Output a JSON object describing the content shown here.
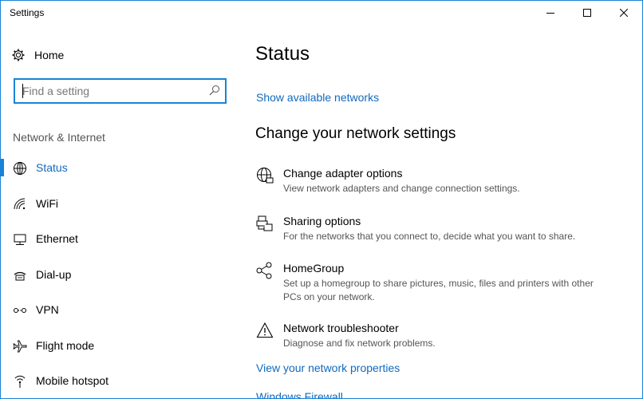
{
  "window": {
    "title": "Settings"
  },
  "sidebar": {
    "home_label": "Home",
    "search_placeholder": "Find a setting",
    "section_label": "Network & Internet",
    "items": [
      {
        "label": "Status",
        "icon": "globe-icon"
      },
      {
        "label": "WiFi",
        "icon": "wifi-icon"
      },
      {
        "label": "Ethernet",
        "icon": "ethernet-icon"
      },
      {
        "label": "Dial-up",
        "icon": "dialup-icon"
      },
      {
        "label": "VPN",
        "icon": "vpn-icon"
      },
      {
        "label": "Flight mode",
        "icon": "airplane-icon"
      },
      {
        "label": "Mobile hotspot",
        "icon": "hotspot-icon"
      }
    ]
  },
  "main": {
    "title": "Status",
    "show_networks_link": "Show available networks",
    "section_heading": "Change your network settings",
    "options": [
      {
        "title": "Change adapter options",
        "description": "View network adapters and change connection settings.",
        "icon": "adapter-icon"
      },
      {
        "title": "Sharing options",
        "description": "For the networks that you connect to, decide what you want to share.",
        "icon": "sharing-icon"
      },
      {
        "title": "HomeGroup",
        "description": "Set up a homegroup to share pictures, music, files and printers with other PCs on your network.",
        "icon": "homegroup-icon"
      },
      {
        "title": "Network troubleshooter",
        "description": "Diagnose and fix network problems.",
        "icon": "warning-icon"
      }
    ],
    "network_properties_link": "View your network properties",
    "firewall_link": "Windows Firewall"
  },
  "colors": {
    "accent": "#1883d7",
    "link": "#1169be"
  }
}
